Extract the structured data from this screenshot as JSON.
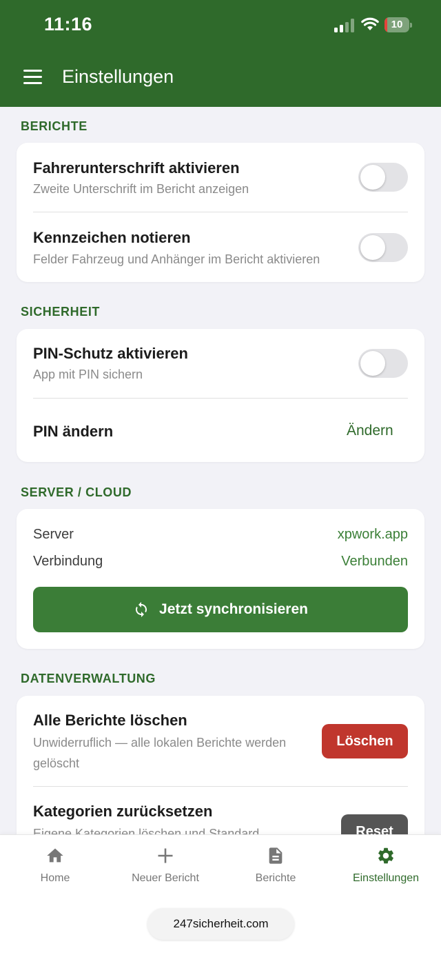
{
  "status_bar": {
    "time": "11:16",
    "battery": "10",
    "battery_level_percent": 10
  },
  "header": {
    "title": "Einstellungen",
    "menu_icon": "hamburger-menu-icon"
  },
  "sections": {
    "berichte": {
      "title": "BERICHTE",
      "rows": [
        {
          "title": "Fahrerunterschrift aktivieren",
          "subtitle": "Zweite Unterschrift im Bericht anzeigen",
          "enabled": false
        },
        {
          "title": "Kennzeichen notieren",
          "subtitle": "Felder Fahrzeug und Anhänger im Bericht aktivieren",
          "enabled": false
        }
      ]
    },
    "sicherheit": {
      "title": "SICHERHEIT",
      "pin_toggle": {
        "title": "PIN-Schutz aktivieren",
        "subtitle": "App mit PIN sichern",
        "enabled": false
      },
      "pin_change": {
        "title": "PIN ändern",
        "action": "Ändern"
      }
    },
    "server": {
      "title": "SERVER / CLOUD",
      "server_label": "Server",
      "server_value": "xpwork.app",
      "connection_label": "Verbindung",
      "connection_value": "Verbunden",
      "sync_button": "Jetzt synchronisieren"
    },
    "daten": {
      "title": "DATENVERWALTUNG",
      "delete_reports": {
        "title": "Alle Berichte löschen",
        "subtitle_line1": "Unwiderruflich — alle lokalen Berichte werden",
        "subtitle_line2": "gelöscht",
        "button": "Löschen"
      },
      "reset_categories": {
        "title": "Kategorien zurücksetzen",
        "subtitle": "Eigene Kategorien löschen und Standard",
        "button": "Reset"
      }
    }
  },
  "tabbar": {
    "tabs": [
      {
        "label": "Home",
        "icon": "home-icon"
      },
      {
        "label": "Neuer Bericht",
        "icon": "plus-icon"
      },
      {
        "label": "Berichte",
        "icon": "document-icon"
      },
      {
        "label": "Einstellungen",
        "icon": "gear-icon"
      }
    ],
    "active": "Einstellungen"
  },
  "browser": {
    "url": "247sicherheit.com"
  },
  "colors": {
    "primary": "#2f6a2b",
    "accent_text": "#3b7f37",
    "danger": "#c0362d",
    "background": "#f2f2f7"
  }
}
